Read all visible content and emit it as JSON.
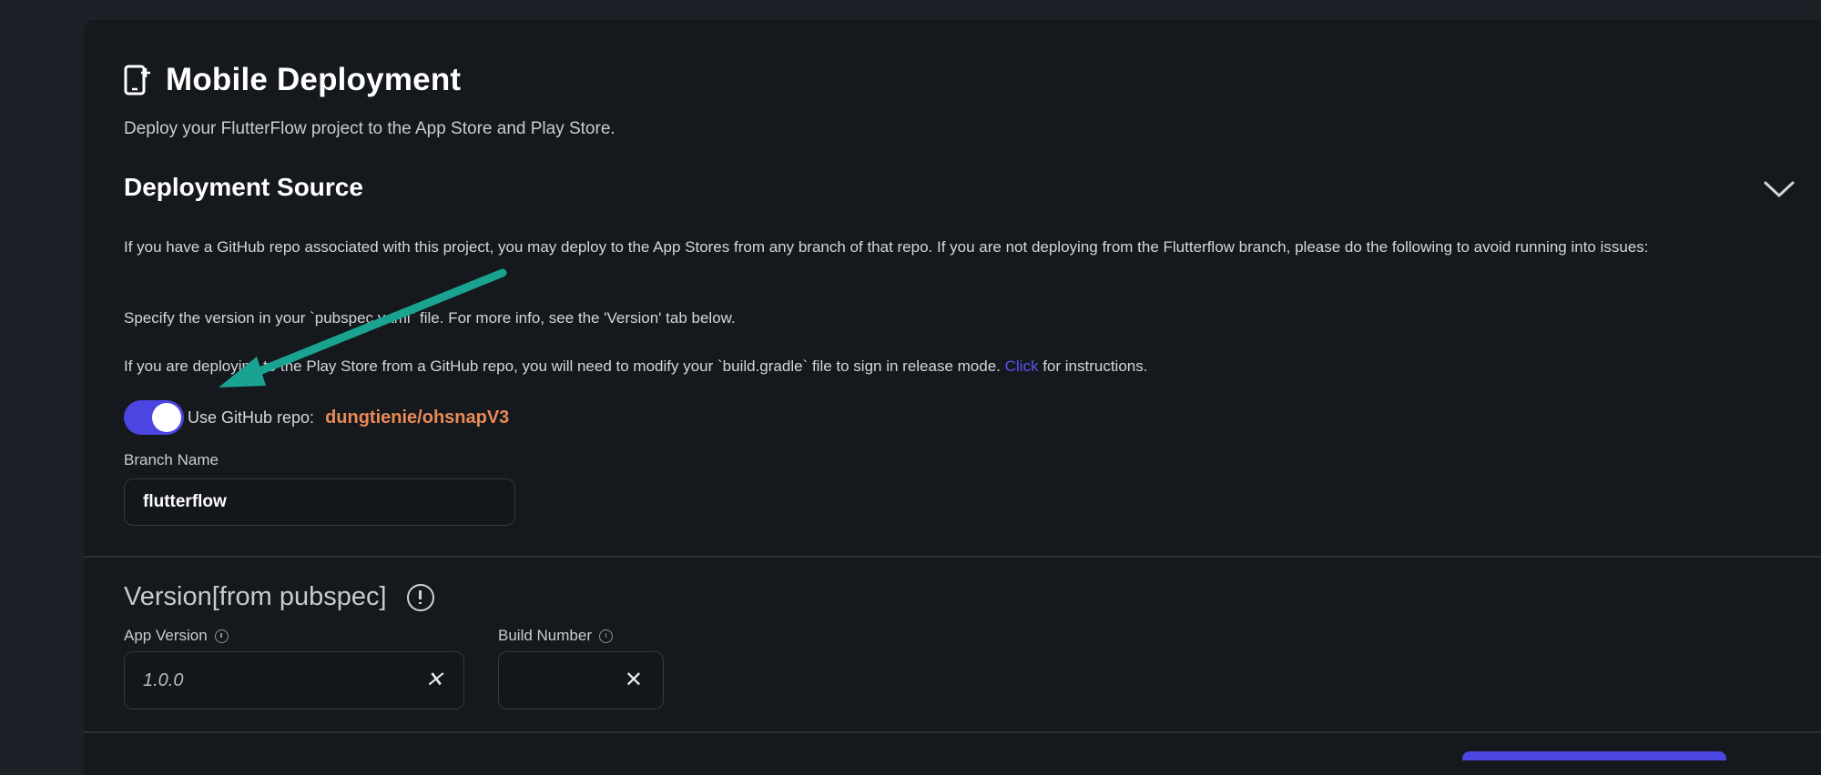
{
  "header": {
    "title": "Mobile Deployment",
    "subtitle": "Deploy your FlutterFlow project to the App Store and Play Store.",
    "icon": "device-deploy-icon"
  },
  "deployment_source": {
    "title": "Deployment Source",
    "paragraph1": "If you have a GitHub repo associated with this project, you may deploy to the App Stores from any branch of that repo. If you are not deploying from the Flutterflow branch, please do the following to avoid running into issues:",
    "paragraph2": "Specify the version in your `pubspec.yaml` file. For more info, see the 'Version' tab below.",
    "paragraph3_before": "If you are deploying to the Play Store from a GitHub repo, you will need to modify your `build.gradle` file to sign in release mode.",
    "paragraph3_link": "Click",
    "paragraph3_after": "for instructions.",
    "toggle_label": "Use GitHub repo:",
    "toggle_on": true,
    "repo_name": "dungtienie/ohsnapV3",
    "branch_label": "Branch Name",
    "branch_value": "flutterflow"
  },
  "version": {
    "title": "Version[from pubspec]",
    "app_version_label": "App Version",
    "app_version_placeholder": "1.0.0",
    "build_number_label": "Build Number",
    "build_number_value": "",
    "clear_symbol": "✕"
  },
  "colors": {
    "accent": "#4b45e2",
    "repo_orange": "#e98a57",
    "annotation_arrow": "#1aa390",
    "link": "#5a53f0"
  }
}
